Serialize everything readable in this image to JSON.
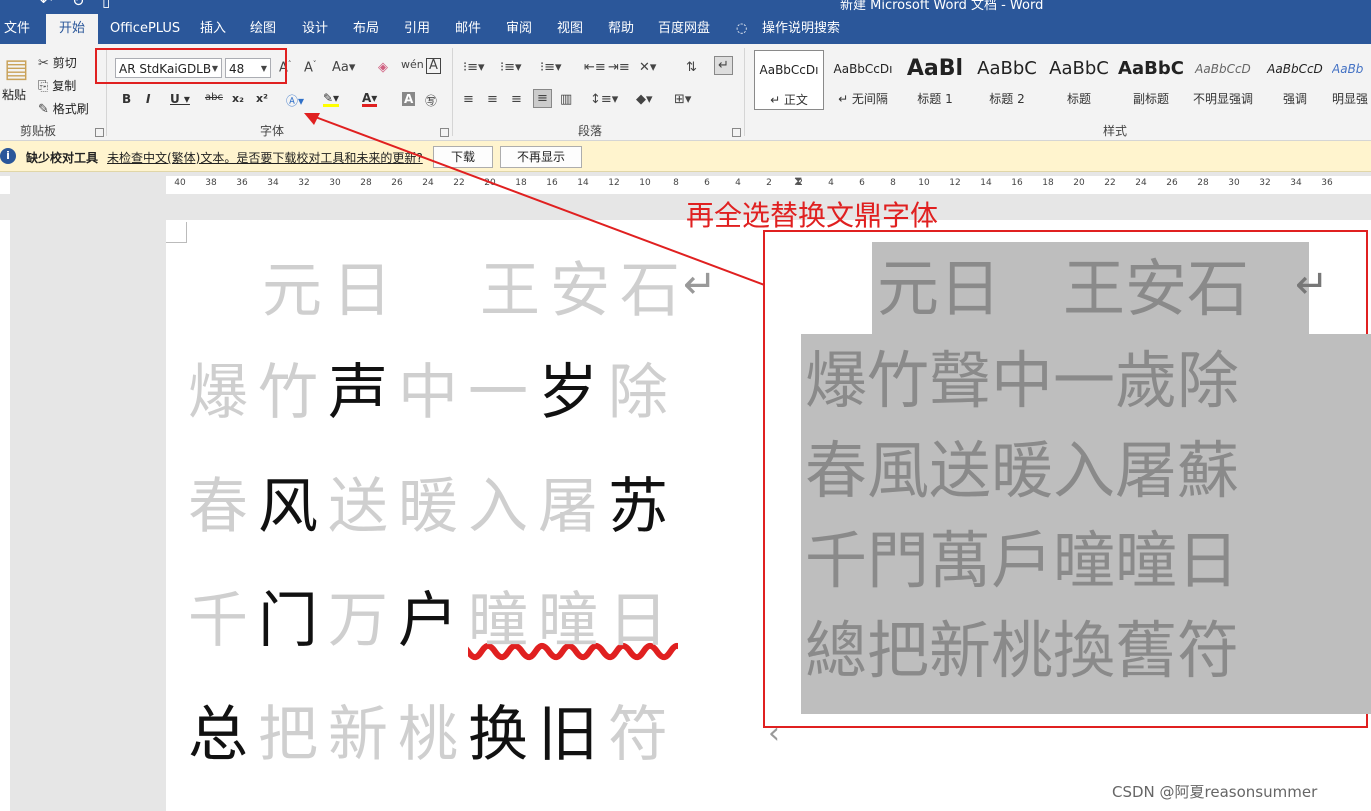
{
  "window": {
    "title": "新建 Microsoft Word 文档 - Word"
  },
  "menu_tabs": [
    "文件",
    "开始",
    "OfficePLUS",
    "插入",
    "绘图",
    "设计",
    "布局",
    "引用",
    "邮件",
    "审阅",
    "视图",
    "帮助",
    "百度网盘"
  ],
  "tell_me": "操作说明搜索",
  "clipboard": {
    "paste": "粘贴",
    "cut": "剪切",
    "copy": "复制",
    "format_painter": "格式刷",
    "group": "剪贴板"
  },
  "font": {
    "name": "AR StdKaiGDLB",
    "size": "48",
    "group": "字体"
  },
  "paragraph": {
    "group": "段落"
  },
  "styles": {
    "group": "样式",
    "items": [
      {
        "preview": "AaBbCcDı",
        "name": "↵ 正文"
      },
      {
        "preview": "AaBbCcDı",
        "name": "↵ 无间隔"
      },
      {
        "preview": "AaBl",
        "name": "标题 1"
      },
      {
        "preview": "AaBbC",
        "name": "标题 2"
      },
      {
        "preview": "AaBbC",
        "name": "标题"
      },
      {
        "preview": "AaBbC",
        "name": "副标题"
      },
      {
        "preview": "AaBbCcD",
        "name": "不明显强调"
      },
      {
        "preview": "AaBbCcD",
        "name": "强调"
      },
      {
        "preview": "AaBb",
        "name": "明显强"
      }
    ]
  },
  "infobar": {
    "title": "缺少校对工具",
    "message": "未检查中文(繁体)文本。是否要下载校对工具和未来的更新?",
    "download": "下载",
    "dismiss": "不再显示"
  },
  "ruler_ticks": [
    "40",
    "38",
    "36",
    "34",
    "32",
    "30",
    "28",
    "26",
    "24",
    "22",
    "20",
    "18",
    "16",
    "14",
    "12",
    "10",
    "8",
    "6",
    "4",
    "2",
    "2",
    "4",
    "6",
    "8",
    "10",
    "12",
    "14",
    "16",
    "18",
    "20",
    "22",
    "24",
    "26",
    "28",
    "30",
    "32",
    "34",
    "36"
  ],
  "document": {
    "title_line": [
      "元日",
      "王安石"
    ],
    "lines": [
      [
        {
          "t": "爆竹",
          "s": false
        },
        {
          "t": "声",
          "s": true
        },
        {
          "t": "中一",
          "s": false
        },
        {
          "t": "岁",
          "s": true
        },
        {
          "t": "除",
          "s": false
        }
      ],
      [
        {
          "t": "春",
          "s": false
        },
        {
          "t": "风",
          "s": true
        },
        {
          "t": "送暖入屠",
          "s": false
        },
        {
          "t": "苏",
          "s": true
        }
      ],
      [
        {
          "t": "千",
          "s": false
        },
        {
          "t": "门",
          "s": true
        },
        {
          "t": "万",
          "s": false
        },
        {
          "t": "户",
          "s": true
        },
        {
          "t": "曈曈日",
          "s": false
        }
      ],
      [
        {
          "t": "总",
          "s": true
        },
        {
          "t": "把新桃",
          "s": false
        },
        {
          "t": "换旧",
          "s": true
        },
        {
          "t": "符",
          "s": false
        }
      ]
    ]
  },
  "converted": {
    "title_line": "元日　王安石",
    "lines": [
      "爆竹聲中一歲除",
      "春風送暖入屠蘇",
      "千門萬戶曈曈日",
      "總把新桃換舊符"
    ]
  },
  "annotation": "再全选替换文鼎字体",
  "watermark": "CSDN @阿夏reasonsummer",
  "colors": {
    "brand": "#2b579a",
    "annotation": "#e02020",
    "infobar": "#fff4ce"
  }
}
